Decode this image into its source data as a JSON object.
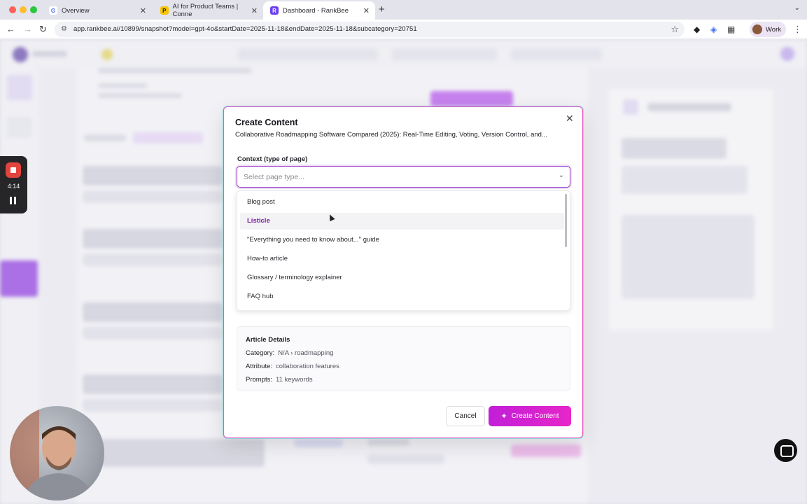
{
  "browser": {
    "tabs": [
      {
        "title": "Overview",
        "favicon": "G"
      },
      {
        "title": "AI for Product Teams | Conne",
        "favicon": "P"
      },
      {
        "title": "Dashboard - RankBee",
        "favicon": "R"
      }
    ],
    "url": "app.rankbee.ai/10899/snapshot?model=gpt-4o&startDate=2025-11-18&endDate=2025-11-18&subcategory=20751",
    "profile_label": "Work"
  },
  "recorder": {
    "time": "4:14"
  },
  "modal": {
    "title": "Create Content",
    "subtitle": "Collaborative Roadmapping Software Compared (2025): Real-Time Editing, Voting, Version Control, and...",
    "context_label": "Context (type of page)",
    "select_placeholder": "Select page type...",
    "options": [
      "Blog post",
      "Listicle",
      "\"Everything you need to know about...\" guide",
      "How-to article",
      "Glossary / terminology explainer",
      "FAQ hub"
    ],
    "highlighted_option": "Listicle",
    "details": {
      "heading": "Article Details",
      "category_label": "Category:",
      "category_value": "N/A › roadmapping",
      "attribute_label": "Attribute:",
      "attribute_value": "collaboration features",
      "prompts_label": "Prompts:",
      "prompts_value": "11 keywords"
    },
    "cancel_label": "Cancel",
    "create_label": "Create Content"
  },
  "colors": {
    "accent": "#c21fd8",
    "select_border": "#9333c8",
    "highlight_text": "#7a1f9c"
  }
}
